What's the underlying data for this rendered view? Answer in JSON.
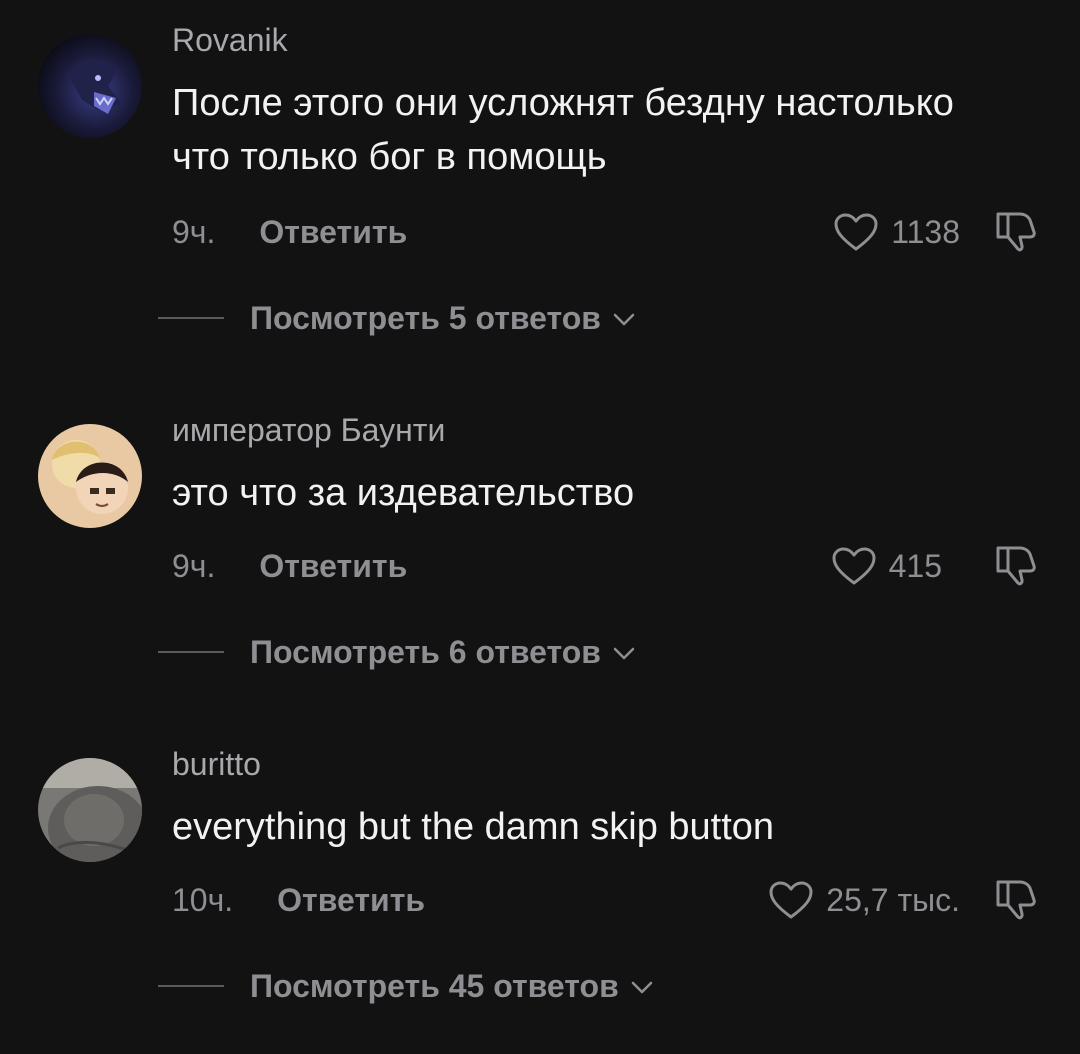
{
  "comments": [
    {
      "username": "Rovanik",
      "text": "После этого они усложнят бездну настолько что только бог в помощь",
      "time": "9ч.",
      "reply_label": "Ответить",
      "likes": "1138",
      "view_replies_label": "Посмотреть 5 ответов",
      "avatar_icon": "dragon-avatar"
    },
    {
      "username": "император Баунти",
      "text": "это что за издевательство",
      "time": "9ч.",
      "reply_label": "Ответить",
      "likes": "415",
      "view_replies_label": "Посмотреть 6 ответов",
      "avatar_icon": "anime-characters-avatar"
    },
    {
      "username": "buritto",
      "text": "everything but the damn skip button",
      "time": "10ч.",
      "reply_label": "Ответить",
      "likes": "25,7 тыс.",
      "view_replies_label": "Посмотреть 45 ответов",
      "avatar_icon": "gray-cat-avatar"
    }
  ],
  "colors": {
    "background": "#121212",
    "username": "#a9a9ad",
    "text": "#f2f2f2",
    "meta": "#8e8e93"
  }
}
